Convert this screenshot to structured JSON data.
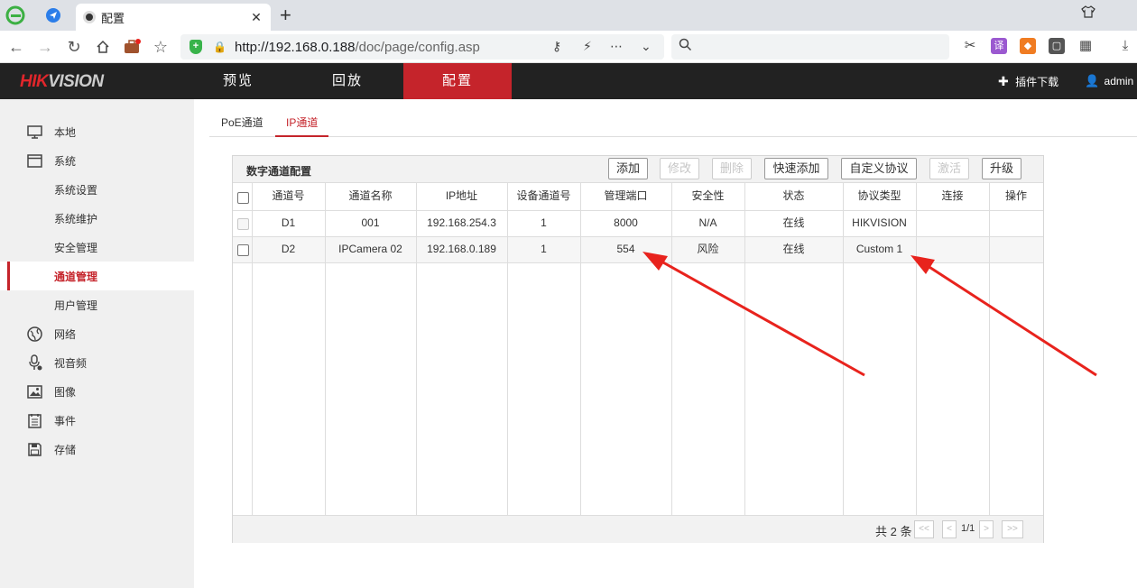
{
  "browser": {
    "tab_title": "配置",
    "url_host": "http://192.168.0.188",
    "url_path": "/doc/page/config.asp"
  },
  "app": {
    "logo_hik": "HIK",
    "logo_vision": "VISION",
    "nav": [
      "预览",
      "回放",
      "配置"
    ],
    "plugin_download": "插件下载",
    "user": "admin"
  },
  "sidebar": {
    "items": [
      {
        "label": "本地",
        "icon": "monitor-icon"
      },
      {
        "label": "系统",
        "icon": "system-window-icon"
      },
      {
        "label": "系统设置",
        "icon": ""
      },
      {
        "label": "系统维护",
        "icon": ""
      },
      {
        "label": "安全管理",
        "icon": ""
      },
      {
        "label": "通道管理",
        "icon": "",
        "active": true
      },
      {
        "label": "用户管理",
        "icon": ""
      },
      {
        "label": "网络",
        "icon": "globe-icon"
      },
      {
        "label": "视音频",
        "icon": "microphone-icon"
      },
      {
        "label": "图像",
        "icon": "image-icon"
      },
      {
        "label": "事件",
        "icon": "event-list-icon"
      },
      {
        "label": "存储",
        "icon": "floppy-disk-icon"
      }
    ]
  },
  "subtabs": [
    "PoE通道",
    "IP通道"
  ],
  "panel": {
    "title": "数字通道配置",
    "buttons": {
      "add": "添加",
      "modify": "修改",
      "delete": "删除",
      "quick_add": "快速添加",
      "custom_protocol": "自定义协议",
      "activate": "激活",
      "upgrade": "升级"
    },
    "columns": [
      "通道号",
      "通道名称",
      "IP地址",
      "设备通道号",
      "管理端口",
      "安全性",
      "状态",
      "协议类型",
      "连接",
      "操作"
    ],
    "rows": [
      {
        "channel": "D1",
        "name": "001",
        "ip": "192.168.254.3",
        "dev_channel": "1",
        "port": "8000",
        "security": "N/A",
        "status": "在线",
        "protocol": "HIKVISION",
        "connection": "",
        "action": ""
      },
      {
        "channel": "D2",
        "name": "IPCamera 02",
        "ip": "192.168.0.189",
        "dev_channel": "1",
        "port": "554",
        "security": "风险",
        "status": "在线",
        "protocol": "Custom 1",
        "connection": "",
        "action": ""
      }
    ],
    "footer": {
      "total": "共 2 条",
      "first": "<<",
      "prev": "<",
      "page": "1/1",
      "next": ">",
      "last": ">>"
    }
  },
  "annotation_color": "#e8231d"
}
